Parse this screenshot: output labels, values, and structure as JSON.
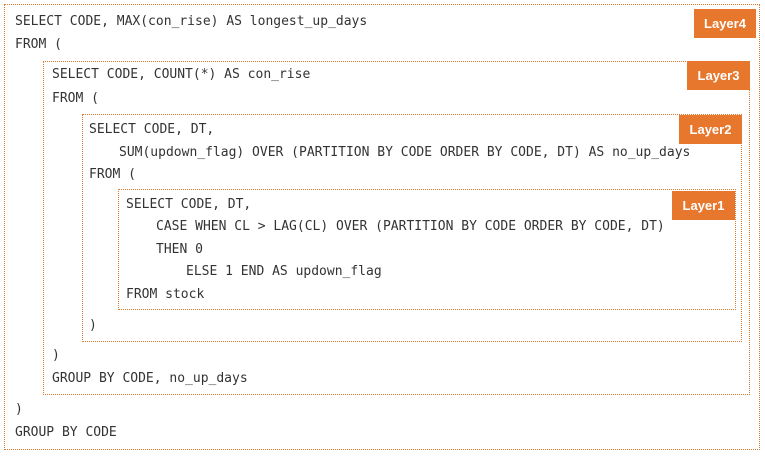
{
  "layers": {
    "l4": "Layer4",
    "l3": "Layer3",
    "l2": "Layer2",
    "l1": "Layer1"
  },
  "code": {
    "l4_select": "SELECT CODE, MAX(con_rise) AS longest_up_days",
    "l4_from": "FROM (",
    "l3_select": "SELECT CODE, COUNT(*) AS con_rise",
    "l3_from": "FROM (",
    "l2_select": "SELECT CODE, DT,",
    "l2_sum": "SUM(updown_flag) OVER (PARTITION BY CODE ORDER BY CODE, DT) AS no_up_days",
    "l2_from": "FROM (",
    "l1_select": "SELECT CODE, DT,",
    "l1_case": "CASE WHEN CL > LAG(CL) OVER (PARTITION BY CODE ORDER BY CODE, DT)",
    "l1_then": "THEN 0",
    "l1_else": "ELSE 1 END AS updown_flag",
    "l1_from": "FROM stock",
    "l2_close": ")",
    "l3_close": ")",
    "l3_group": "GROUP BY CODE, no_up_days",
    "l4_close": ")",
    "l4_group": "GROUP BY CODE"
  }
}
